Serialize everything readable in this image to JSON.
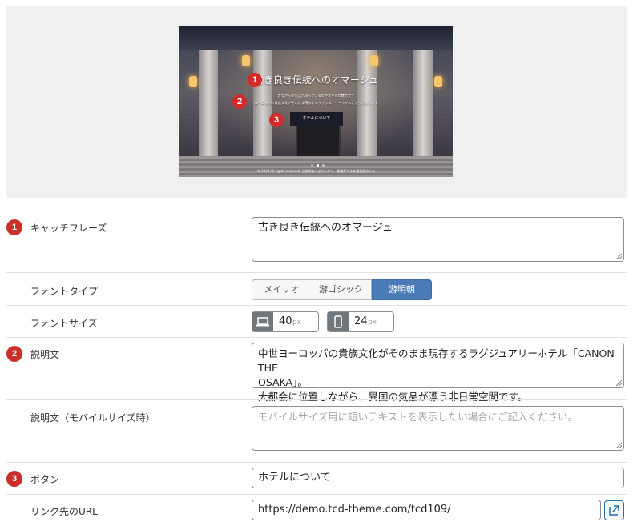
{
  "preview": {
    "title": "古き良き伝統へのオマージュ",
    "desc_line1": "昔ながらの気品が漂っているのがホテルの魅力です",
    "desc_line2": "ヨーロッパの貴族文化がそのまま現存するラグジュアリーホテルとなっております",
    "button_label": "ホテルについて",
    "footer": "© 2024 All rights reserved. 伝統的なラグジュアリー体験ができる最高級ホテル",
    "markers": [
      "1",
      "2",
      "3"
    ]
  },
  "catchphrase": {
    "number": "1",
    "label": "キャッチフレーズ",
    "value": "古き良き伝統へのオマージュ"
  },
  "font_type": {
    "label": "フォントタイプ",
    "options": [
      "メイリオ",
      "游ゴシック",
      "游明朝"
    ],
    "selected": "游明朝"
  },
  "font_size": {
    "label": "フォントサイズ",
    "desktop_value": "40",
    "mobile_value": "24",
    "unit": "px"
  },
  "description": {
    "number": "2",
    "label": "説明文",
    "line1": "中世ヨーロッパの貴族文化がそのまま現存するラグジュアリーホテル「CANON THE",
    "line2": "OSAKA」。",
    "line3": "大都会に位置しながら、異国の気品が漂う非日常空間です。"
  },
  "description_mobile": {
    "label": "説明文（モバイルサイズ時）",
    "placeholder": "モバイルサイズ用に短いテキストを表示したい場合にご記入ください。"
  },
  "button": {
    "number": "3",
    "label": "ボタン",
    "value": "ホテルについて"
  },
  "link_url": {
    "label": "リンク先のURL",
    "value": "https://demo.tcd-theme.com/tcd109/"
  },
  "colors": {
    "accent": "#4a7bb6",
    "badge": "#c9302c",
    "link_border": "#2271b1"
  }
}
